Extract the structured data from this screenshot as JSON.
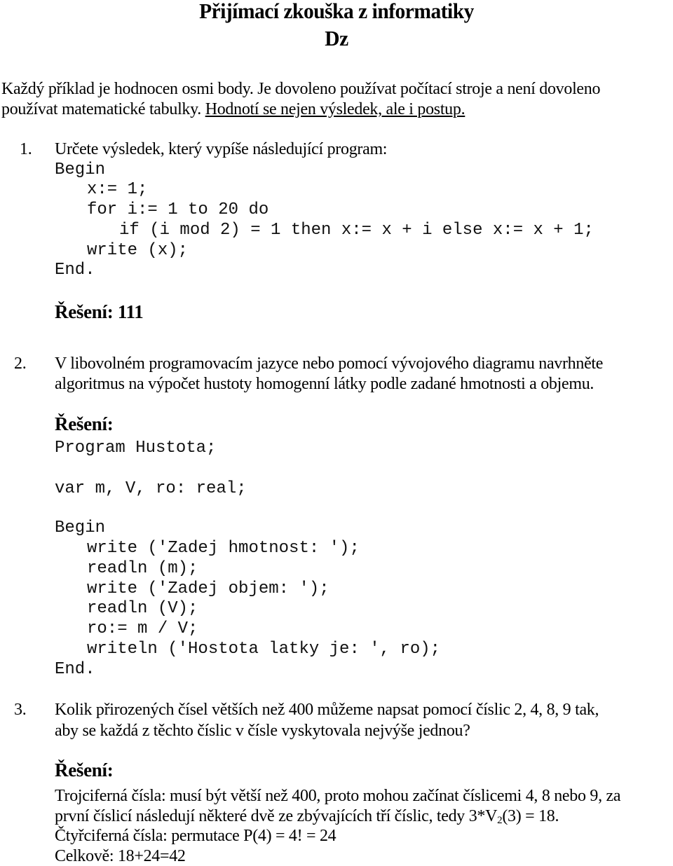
{
  "header": {
    "title_line1": "Přijímací zkouška z informatiky",
    "title_line2": "Dz"
  },
  "intro": {
    "line1": "Každý příklad je hodnocen osmi body. Je dovoleno používat počítací stroje a není dovoleno",
    "line2_plain": "používat matematické tabulky. ",
    "line2_underlined": "Hodnotí se nejen výsledek, ale i postup."
  },
  "task1": {
    "number": "1.",
    "question": "Určete výsledek, který vypíše následující program:",
    "code": [
      "Begin",
      "x:= 1;",
      "for i:= 1 to 20 do",
      "if (i mod 2) = 1 then x:= x + i else x:= x + 1;",
      "write (x);",
      "End."
    ],
    "solution_label": "Řešení: 111"
  },
  "task2": {
    "number": "2.",
    "question_line1": "V libovolném programovacím jazyce nebo pomocí vývojového diagramu navrhněte",
    "question_line2": "algoritmus na výpočet hustoty homogenní látky podle zadané hmotnosti a objemu.",
    "solution_label": "Řešení:",
    "code": [
      "Program Hustota;",
      "var m, V, ro: real;",
      "Begin",
      "write ('Zadej hmotnost: ');",
      "readln (m);",
      "write ('Zadej objem: ');",
      "readln (V);",
      "ro:= m / V;",
      "writeln ('Hostota latky je: ', ro);",
      "End."
    ]
  },
  "task3": {
    "number": "3.",
    "question_line1": "Kolik přirozených čísel větších než 400 můžeme napsat pomocí číslic 2, 4, 8, 9 tak,",
    "question_line2": "aby se každá z těchto číslic v čísle vyskytovala nejvýše jednou?",
    "solution_label": "Řešení:",
    "solution_line1": "Trojciferná čísla: musí být větší než 400, proto mohou začínat číslicemi 4, 8 nebo 9, za",
    "solution_line2_a": "první číslicí následují některé dvě ze zbývajících tří číslic, tedy 3*V",
    "solution_line2_sub": "2",
    "solution_line2_b": "(3) = 18.",
    "solution_line3": "Čtyřciferná čísla: permutace P(4) = 4! = 24",
    "solution_line4": "Celkově: 18+24=42"
  }
}
